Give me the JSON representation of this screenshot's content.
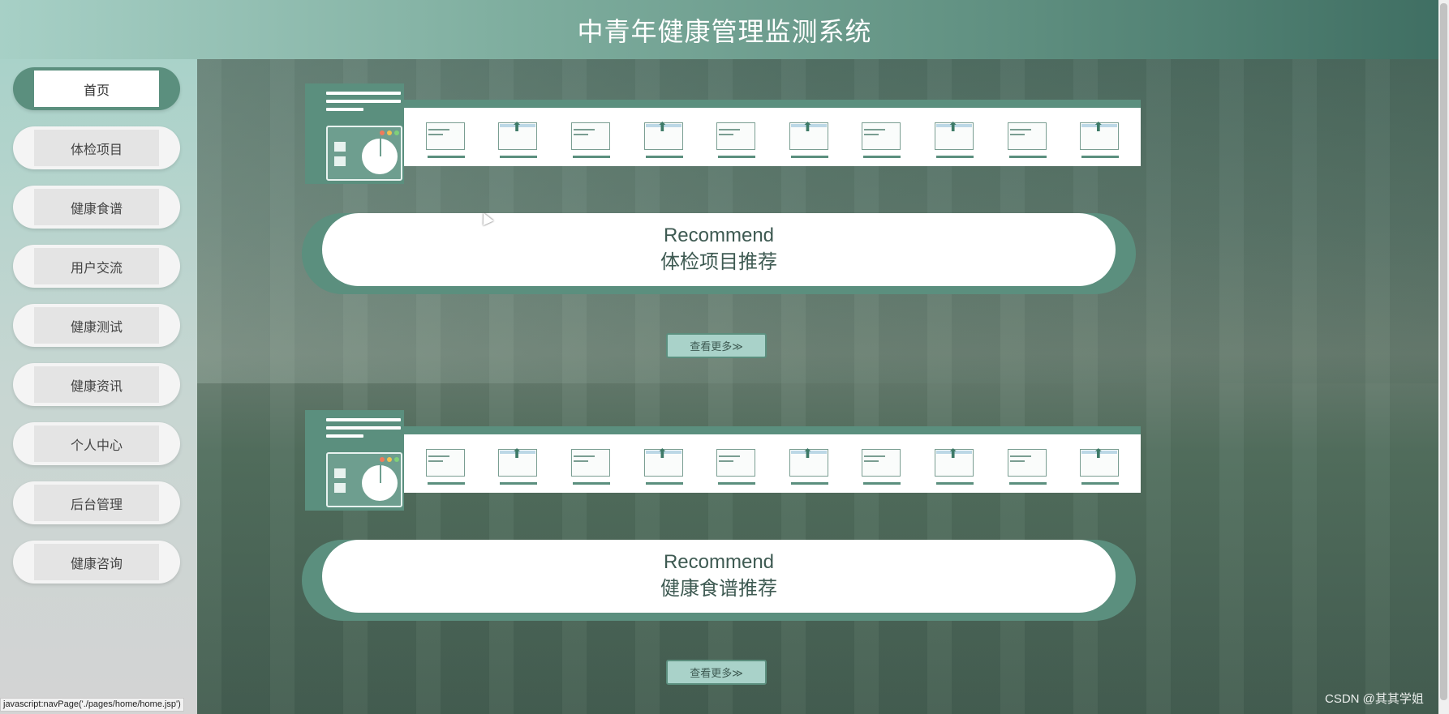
{
  "header": {
    "title": "中青年健康管理监测系统"
  },
  "sidebar": {
    "items": [
      {
        "label": "首页",
        "active": true
      },
      {
        "label": "体检项目",
        "active": false
      },
      {
        "label": "健康食谱",
        "active": false
      },
      {
        "label": "用户交流",
        "active": false
      },
      {
        "label": "健康测试",
        "active": false
      },
      {
        "label": "健康资讯",
        "active": false
      },
      {
        "label": "个人中心",
        "active": false
      },
      {
        "label": "后台管理",
        "active": false
      },
      {
        "label": "健康咨询",
        "active": false
      }
    ]
  },
  "sections": [
    {
      "recommend_en": "Recommend",
      "recommend_cn": "体检项目推荐",
      "more_label": "查看更多≫"
    },
    {
      "recommend_en": "Recommend",
      "recommend_cn": "健康食谱推荐",
      "more_label": "查看更多≫"
    }
  ],
  "status_bar": {
    "url": "javascript:navPage('./pages/home/home.jsp')"
  },
  "watermark": "CSDN @其其学姐",
  "colors": {
    "primary": "#5b8f7e",
    "light": "#a9d2c9",
    "header_end": "#3f6e62"
  }
}
